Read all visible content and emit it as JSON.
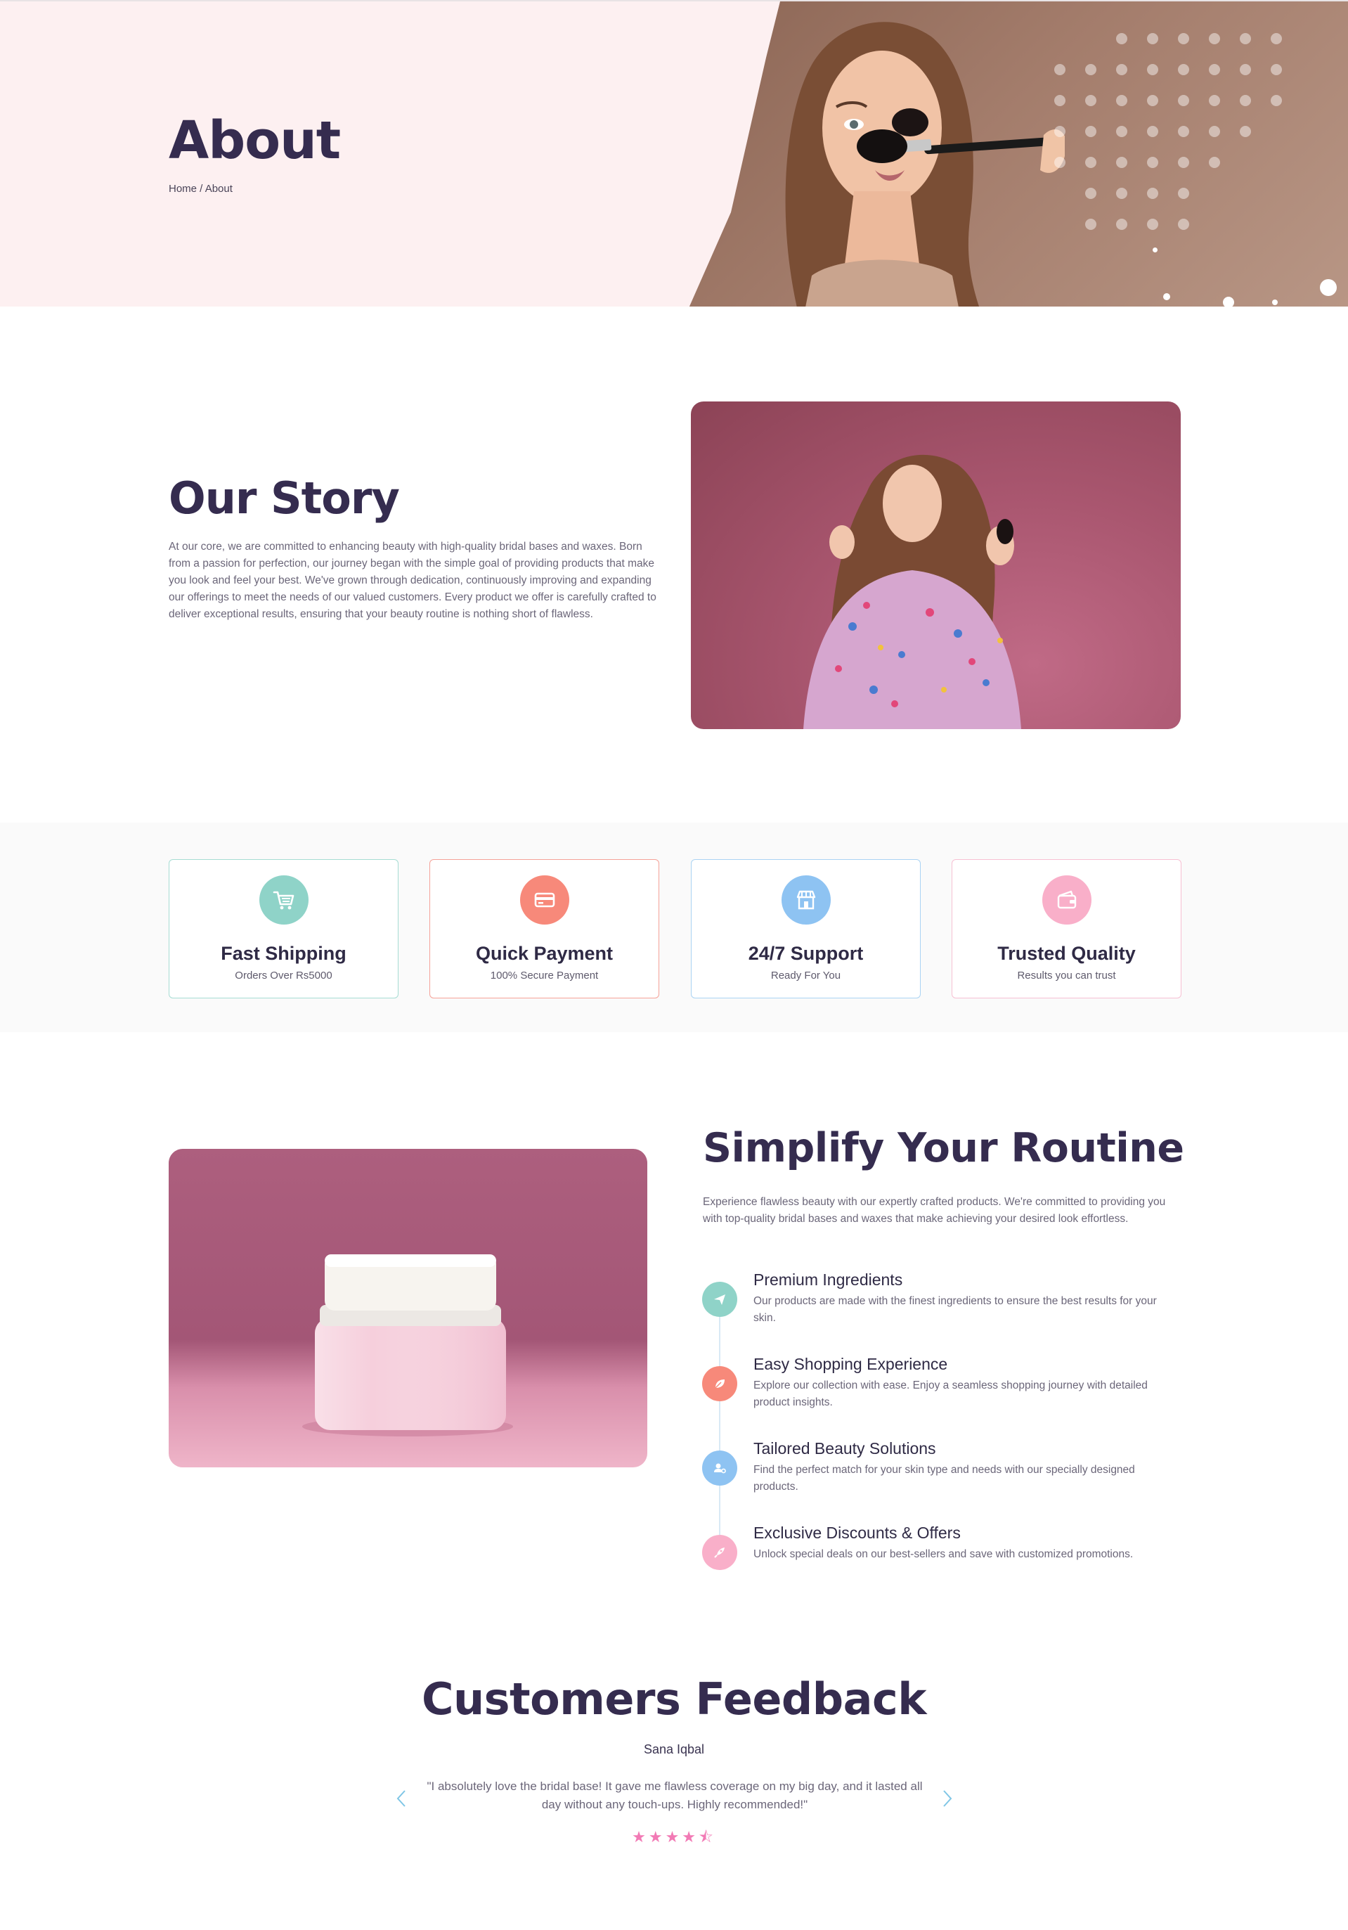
{
  "hero": {
    "title": "About",
    "breadcrumb": {
      "home": "Home",
      "separator": " / ",
      "current": "About"
    }
  },
  "story": {
    "title": "Our Story",
    "text": "At our core, we are committed to enhancing beauty with high-quality bridal bases and waxes. Born from a passion for perfection, our journey began with the simple goal of providing products that make you look and feel your best. We've grown through dedication, continuously improving and expanding our offerings to meet the needs of our valued customers. Every product we offer is carefully crafted to deliver exceptional results, ensuring that your beauty routine is nothing short of flawless."
  },
  "features": [
    {
      "title": "Fast Shipping",
      "subtitle": "Orders Over Rs5000",
      "icon": "cart-icon",
      "color": "#8fd3c8",
      "border": "#a6dcd3"
    },
    {
      "title": "Quick Payment",
      "subtitle": "100% Secure Payment",
      "icon": "credit-card-icon",
      "color": "#f7897a",
      "border": "#f5a298"
    },
    {
      "title": "24/7 Support",
      "subtitle": "Ready For You",
      "icon": "store-icon",
      "color": "#8ec3f2",
      "border": "#aad3f3"
    },
    {
      "title": "Trusted Quality",
      "subtitle": "Results you can trust",
      "icon": "wallet-icon",
      "color": "#f9afc9",
      "border": "#f7c0d3"
    }
  ],
  "routine": {
    "title": "Simplify Your Routine",
    "text": "Experience flawless beauty with our expertly crafted products. We're committed to providing you with top-quality bridal bases and waxes that make achieving your desired look effortless.",
    "items": [
      {
        "title": "Premium Ingredients",
        "text": "Our products are made with the finest ingredients to ensure the best results for your skin.",
        "icon": "paper-plane-icon",
        "color": "#8fd3c8"
      },
      {
        "title": "Easy Shopping Experience",
        "text": "Explore our collection with ease. Enjoy a seamless shopping journey with detailed product insights.",
        "icon": "leaf-icon",
        "color": "#f7897a"
      },
      {
        "title": "Tailored Beauty Solutions",
        "text": "Find the perfect match for your skin type and needs with our specially designed products.",
        "icon": "user-gear-icon",
        "color": "#8ec3f2"
      },
      {
        "title": "Exclusive Discounts & Offers",
        "text": "Unlock special deals on our best-sellers and save with customized promotions.",
        "icon": "rocket-icon",
        "color": "#f9afc9"
      }
    ]
  },
  "feedback": {
    "title": "Customers Feedback",
    "name": "Sana Iqbal",
    "quote": "\"I absolutely love the bridal base! It gave me flawless coverage on my big day, and it lasted all day without any touch-ups. Highly recommended!\"",
    "stars": "★★★★⯪",
    "rating": 4.5,
    "prev_icon": "chevron-left-icon",
    "next_icon": "chevron-right-icon",
    "arrow_color": "#7fc6e6"
  }
}
